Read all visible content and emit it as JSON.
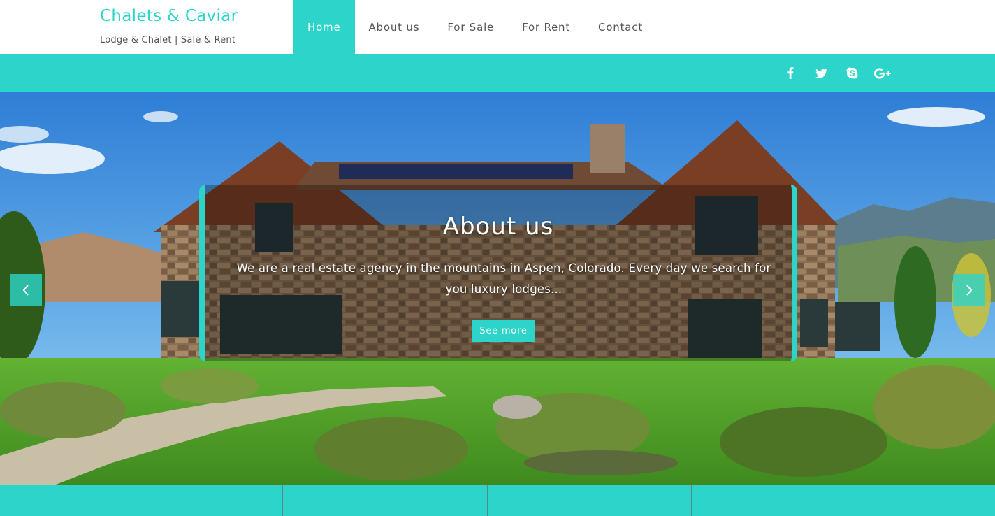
{
  "brand": {
    "title": "Chalets & Caviar",
    "subtitle": "Lodge & Chalet | Sale & Rent"
  },
  "nav": {
    "items": [
      {
        "label": "Home",
        "active": true
      },
      {
        "label": "About us",
        "active": false
      },
      {
        "label": "For Sale",
        "active": false
      },
      {
        "label": "For Rent",
        "active": false
      },
      {
        "label": "Contact",
        "active": false
      }
    ]
  },
  "social": {
    "icons": [
      "facebook-icon",
      "twitter-icon",
      "skype-icon",
      "google-plus-icon"
    ]
  },
  "hero": {
    "title": "About us",
    "text": "We are a real estate agency in the mountains in Aspen, Colorado. Every day we search for you luxury lodges...",
    "button_label": "See more",
    "prev_icon": "chevron-left-icon",
    "next_icon": "chevron-right-icon"
  },
  "colors": {
    "accent": "#2dd4c9",
    "text": "#555555",
    "white": "#ffffff"
  }
}
